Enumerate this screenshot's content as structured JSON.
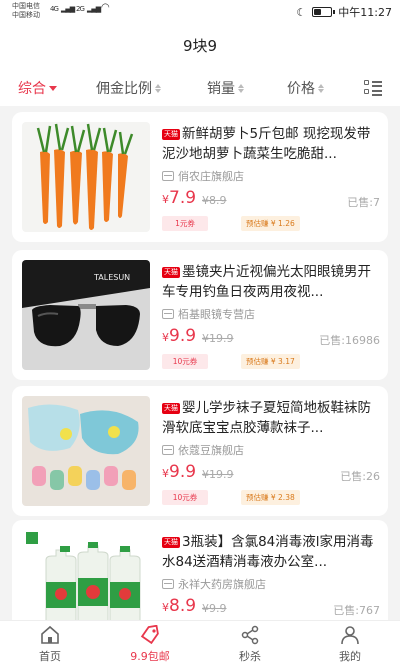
{
  "status": {
    "carrier1": "中国电信",
    "carrier2": "中国移动",
    "net1": "4G",
    "net2": "2G",
    "time": "中午11:27"
  },
  "header": {
    "title": "9块9"
  },
  "sort": {
    "items": [
      {
        "label": "综合"
      },
      {
        "label": "佣金比例"
      },
      {
        "label": "销量"
      },
      {
        "label": "价格"
      }
    ]
  },
  "products": [
    {
      "title": "新鲜胡萝卜5斤包邮 现挖现发带泥沙地胡萝卜蔬菜生吃脆甜...",
      "shop": "俏农庄旗舰店",
      "currency": "¥",
      "price": "7.9",
      "original": "¥8.9",
      "sold": "已售:7",
      "coupon": "1元券",
      "earn": "预估赚 ¥ 1.26",
      "colors": {
        "bg": "#ffffff",
        "main": "#f07a1e"
      }
    },
    {
      "title": "墨镜夹片近视偏光太阳眼镜男开车专用钓鱼日夜两用夜视...",
      "shop": "栢基眼镜专营店",
      "currency": "¥",
      "price": "9.9",
      "original": "¥19.9",
      "sold": "已售:16986",
      "coupon": "10元券",
      "earn": "预估赚 ¥ 3.17",
      "colors": {
        "bg": "#d8d8d8",
        "main": "#1e1e1e"
      }
    },
    {
      "title": "婴儿学步袜子夏短简地板鞋袜防滑软底宝宝点胶薄款袜子...",
      "shop": "依蔻豆旗舰店",
      "currency": "¥",
      "price": "9.9",
      "original": "¥19.9",
      "sold": "已售:26",
      "coupon": "10元券",
      "earn": "预估赚 ¥ 2.38",
      "colors": {
        "bg": "#e9e3dc",
        "main": "#7fc8d8"
      }
    },
    {
      "title": "3瓶装】含氯84消毒液l家用消毒水84送酒精消毒液办公室...",
      "shop": "永祥大药房旗舰店",
      "currency": "¥",
      "price": "8.9",
      "original": "¥9.9",
      "sold": "已售:767",
      "coupon": "",
      "earn": "",
      "colors": {
        "bg": "#ffffff",
        "main": "#2f9e44"
      }
    }
  ],
  "tabbar": {
    "items": [
      {
        "label": "首页"
      },
      {
        "label": "9.9包邮"
      },
      {
        "label": "秒杀"
      },
      {
        "label": "我的"
      }
    ]
  },
  "brand_mark": "天猫",
  "accent": "#e8374c"
}
